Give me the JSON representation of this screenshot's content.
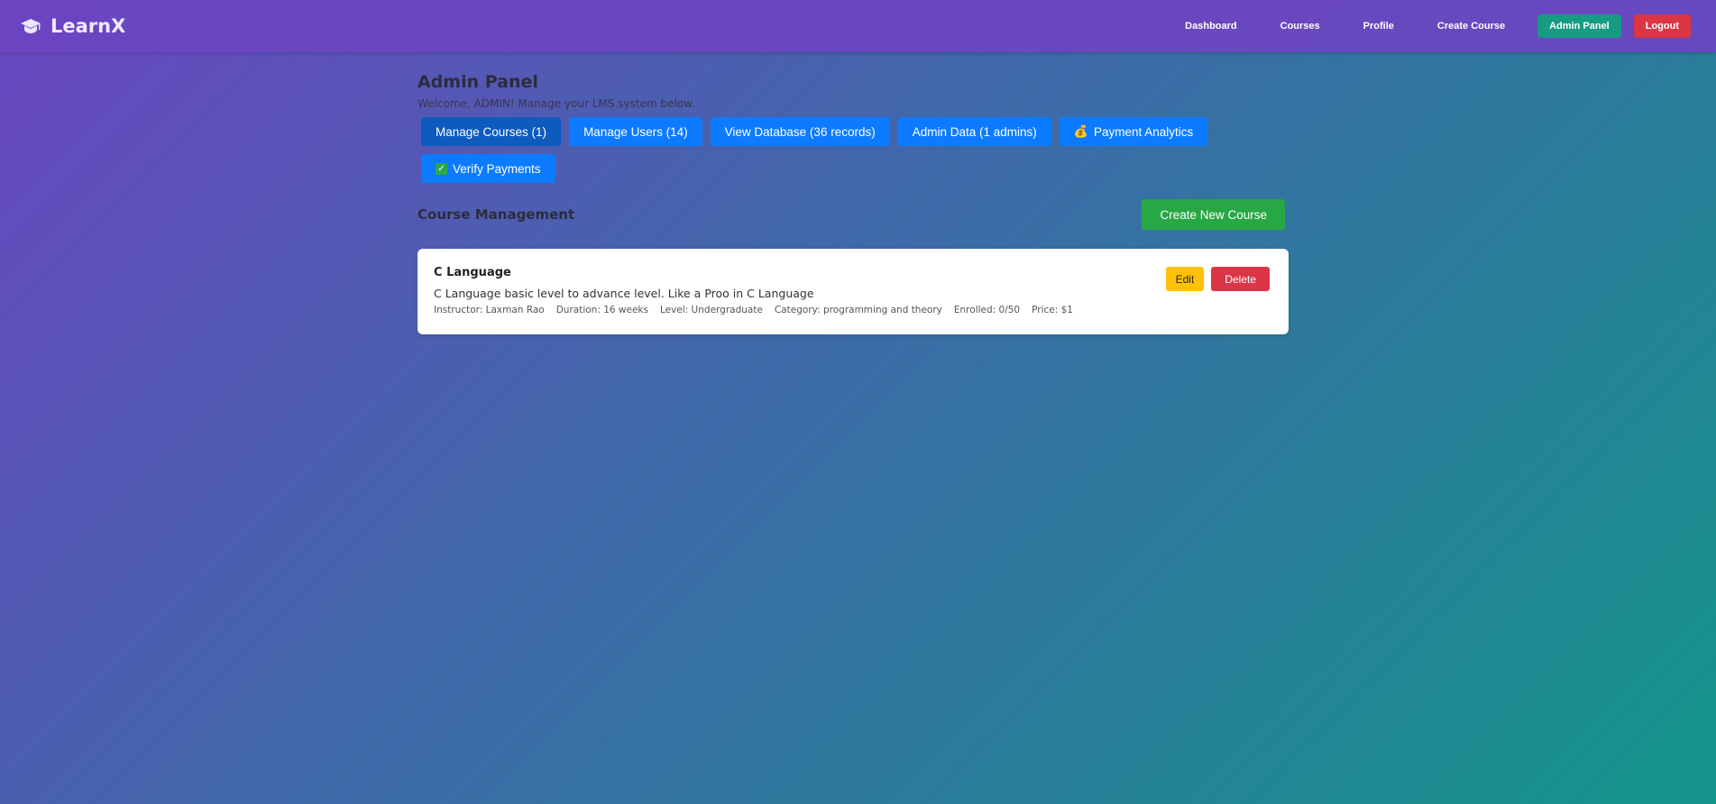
{
  "app": {
    "name": "LearnX",
    "logo_icon": "graduation-cap-icon"
  },
  "nav": {
    "items": [
      {
        "label": "Dashboard"
      },
      {
        "label": "Courses"
      },
      {
        "label": "Profile"
      },
      {
        "label": "Create Course"
      }
    ],
    "admin_label": "Admin Panel",
    "logout_label": "Logout"
  },
  "main": {
    "title": "Admin Panel",
    "welcome": "Welcome, ADMIN! Manage your LMS system below.",
    "tabs": [
      {
        "label": "Manage Courses (1)",
        "active": true
      },
      {
        "label": "Manage Users (14)"
      },
      {
        "label": "View Database (36 records)"
      },
      {
        "label": "Admin Data (1 admins)"
      },
      {
        "label": "Payment Analytics",
        "icon": "money-bag-icon"
      },
      {
        "label": "Verify Payments",
        "icon": "check-box-icon"
      }
    ],
    "section_title": "Course Management",
    "create_button": "Create New Course",
    "courses": [
      {
        "name": "C Language",
        "description": "C Language basic level to advance level. Like a Proo in C Language",
        "instructor": "Instructor: Laxman Rao",
        "duration": "Duration: 16 weeks",
        "level": "Level: Undergraduate",
        "category": "Category: programming and theory",
        "enrolled": "Enrolled: 0/50",
        "price": "Price: $1",
        "edit_label": "Edit",
        "delete_label": "Delete"
      }
    ]
  },
  "colors": {
    "primary": "#0d7bff",
    "primary_active": "#0d5bbd",
    "success": "#28a745",
    "danger": "#dc3545",
    "warning": "#ffc107",
    "admin": "#159c82",
    "header": "#6b46c1"
  }
}
